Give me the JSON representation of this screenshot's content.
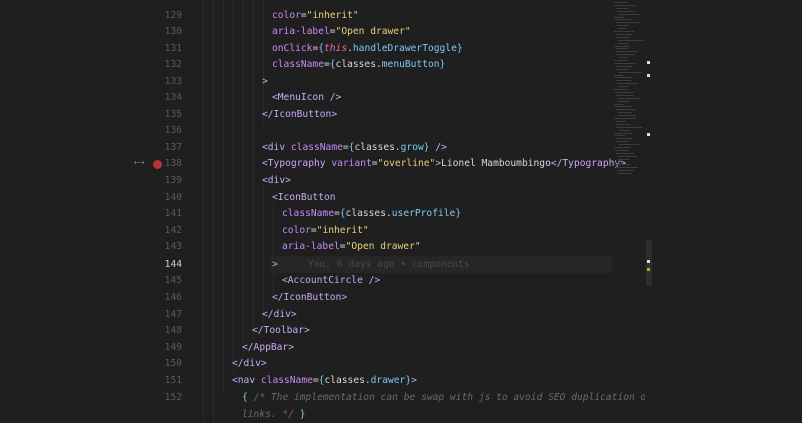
{
  "gutter": {
    "line_numbers": [
      "129",
      "130",
      "131",
      "132",
      "133",
      "134",
      "135",
      "136",
      "137",
      "138",
      "139",
      "140",
      "141",
      "142",
      "143",
      "144",
      "145",
      "146",
      "147",
      "148",
      "149",
      "150",
      "151",
      "152",
      ""
    ]
  },
  "code_lines": [
    "color=\"inherit\"",
    "aria-label=\"Open drawer\"",
    "onClick={this.handleDrawerToggle}",
    "className={classes.menuButton}",
    ">",
    "<MenuIcon />",
    "</IconButton>",
    "",
    "<div className={classes.grow} />",
    "<Typography variant=\"overline\">Lionel Mamboumbingo</Typography>",
    "<div>",
    "<IconButton",
    "className={classes.userProfile}",
    "color=\"inherit\"",
    "aria-label=\"Open drawer\"",
    ">",
    "<AccountCircle />",
    "</IconButton>",
    "</div>",
    "</Toolbar>",
    "</AppBar>",
    "</div>",
    "<nav className={classes.drawer}>",
    "{ /* The implementation can be swap with js to avoid SEO duplication of",
    "links. */ }"
  ],
  "blame_annotation": "You, 6 days ago • components",
  "colors": {
    "background": "#1f1f1f",
    "tag": "#c9a8f4",
    "attribute": "#c58af9",
    "string": "#e6d27a",
    "brace": "#7fc8f8",
    "keyword": "#f06c9b",
    "comment": "#6a6a6a",
    "breakpoint": "#b53434"
  },
  "icons": {
    "breakpoint": "breakpoint-dot-icon",
    "diff_arrows": "split-arrows-icon"
  }
}
